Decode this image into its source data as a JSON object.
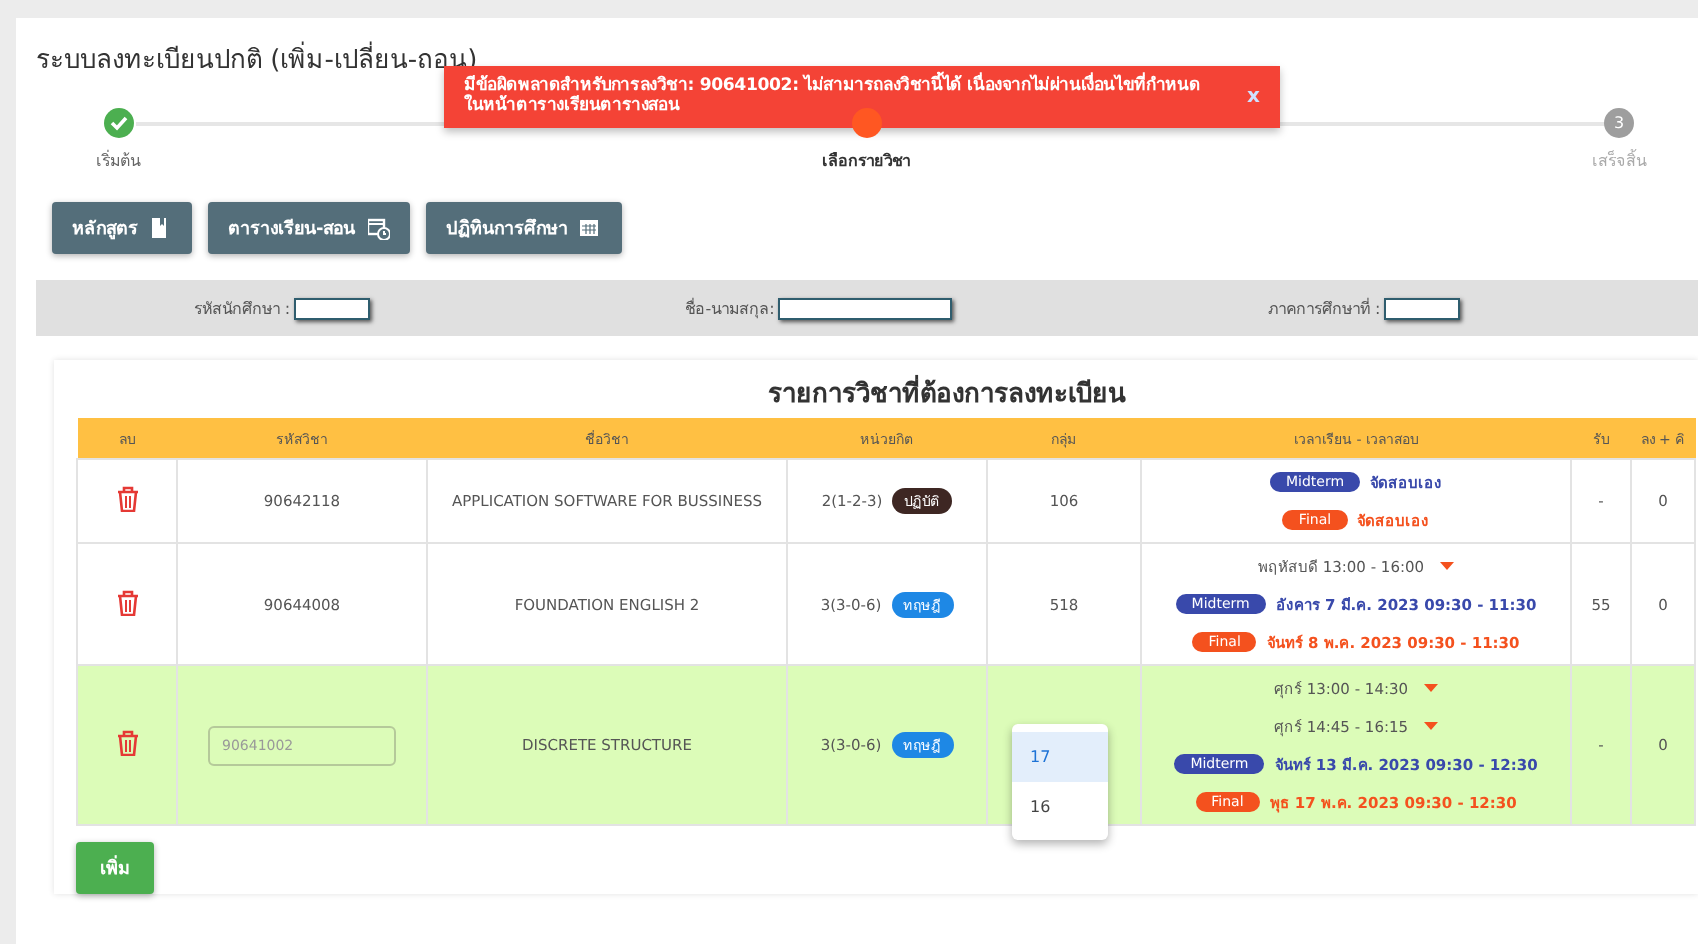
{
  "page_title": "ระบบลงทะเบียนปกติ (เพิ่ม-เปลี่ยน-ถอน)",
  "toast": {
    "message": "มีข้อผิดพลาดสำหรับการลงวิชา: 90641002: ไม่สามารถลงวิชานี้ได้ เนื่องจากไม่ผ่านเงื่อนไขที่กำหนด ในหน้าตารางเรียนตารางสอน",
    "close": "x"
  },
  "steps": [
    {
      "label": "เริ่มต้น",
      "completed": true,
      "current": false
    },
    {
      "label": "เลือกรายวิชา",
      "completed": false,
      "current": true
    },
    {
      "label": "เสร็จสิ้น",
      "completed": false,
      "current": false,
      "number": "3"
    }
  ],
  "buttons": [
    {
      "label": "หลักสูตร"
    },
    {
      "label": "ตารางเรียน-สอน"
    },
    {
      "label": "ปฏิทินการศึกษา"
    }
  ],
  "info_fields": [
    {
      "label": "รหัสนักศึกษา :"
    },
    {
      "label": "ชื่อ-นามสกุล:"
    },
    {
      "label": "ภาคการศึกษาที่ :"
    }
  ],
  "table": {
    "title": "รายการวิชาที่ต้องการลงทะเบียน",
    "columns": [
      "ลบ",
      "รหัสวิชา",
      "ชื่อวิชา",
      "หน่วยกิต",
      "กลุ่ม",
      "เวลาเรียน - เวลาสอบ",
      "รับ",
      "ลง + คิ"
    ],
    "rows": [
      {
        "editing": false,
        "code": "90642118",
        "name": "APPLICATION SOFTWARE FOR BUSSINESS",
        "credits": "2(1-2-3)",
        "type": {
          "kind": "practice",
          "label": "ปฏิบัติ"
        },
        "group": "106",
        "schedule": [],
        "exams": [
          {
            "kind": "midterm",
            "label": "Midterm",
            "text": "จัดสอบเอง"
          },
          {
            "kind": "final",
            "label": "Final",
            "text": "จัดสอบเอง"
          }
        ],
        "seats": "-",
        "enrolled": "0"
      },
      {
        "editing": false,
        "code": "90644008",
        "name": "FOUNDATION ENGLISH 2",
        "credits": "3(3-0-6)",
        "type": {
          "kind": "theory",
          "label": "ทฤษฎี"
        },
        "group": "518",
        "schedule": [
          "พฤหัสบดี 13:00 - 16:00"
        ],
        "exams": [
          {
            "kind": "midterm",
            "label": "Midterm",
            "text": "อังคาร 7 มี.ค. 2023 09:30 - 11:30"
          },
          {
            "kind": "final",
            "label": "Final",
            "text": "จันทร์ 8 พ.ค. 2023 09:30 - 11:30"
          }
        ],
        "seats": "55",
        "enrolled": "0"
      },
      {
        "editing": true,
        "code": "90641002",
        "name": "DISCRETE STRUCTURE",
        "credits": "3(3-0-6)",
        "type": {
          "kind": "theory",
          "label": "ทฤษฎี"
        },
        "group_options": [
          {
            "label": "17",
            "selected": true
          },
          {
            "label": "16",
            "selected": false
          }
        ],
        "schedule": [
          "ศุกร์ 13:00 - 14:30",
          "ศุกร์ 14:45 - 16:15"
        ],
        "exams": [
          {
            "kind": "midterm",
            "label": "Midterm",
            "text": "จันทร์ 13 มี.ค. 2023 09:30 - 12:30"
          },
          {
            "kind": "final",
            "label": "Final",
            "text": "พุธ 17 พ.ค. 2023 09:30 - 12:30"
          }
        ],
        "seats": "-",
        "enrolled": "0"
      }
    ]
  },
  "add_button": "เพิ่ม"
}
